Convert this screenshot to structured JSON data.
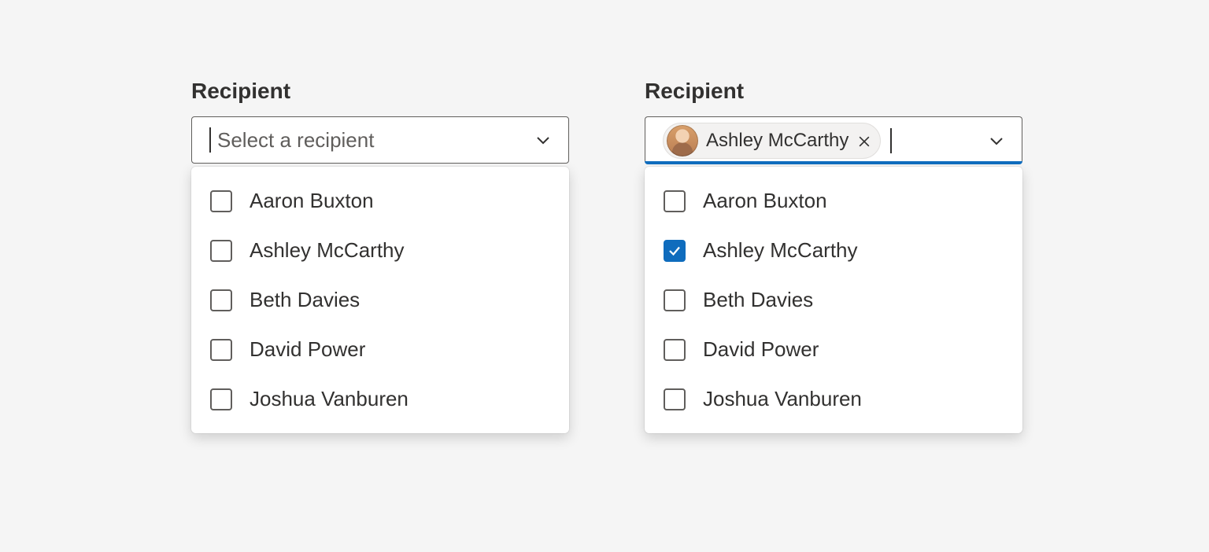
{
  "colors": {
    "accent": "#0f6cbd",
    "text": "#323130",
    "border": "#605e5c"
  },
  "left": {
    "label": "Recipient",
    "placeholder": "Select a recipient",
    "options": [
      {
        "label": "Aaron Buxton",
        "checked": false
      },
      {
        "label": "Ashley McCarthy",
        "checked": false
      },
      {
        "label": "Beth Davies",
        "checked": false
      },
      {
        "label": "David Power",
        "checked": false
      },
      {
        "label": "Joshua Vanburen",
        "checked": false
      }
    ]
  },
  "right": {
    "label": "Recipient",
    "chip_label": "Ashley McCarthy",
    "options": [
      {
        "label": "Aaron Buxton",
        "checked": false
      },
      {
        "label": "Ashley McCarthy",
        "checked": true
      },
      {
        "label": "Beth Davies",
        "checked": false
      },
      {
        "label": "David Power",
        "checked": false
      },
      {
        "label": "Joshua Vanburen",
        "checked": false
      }
    ]
  }
}
